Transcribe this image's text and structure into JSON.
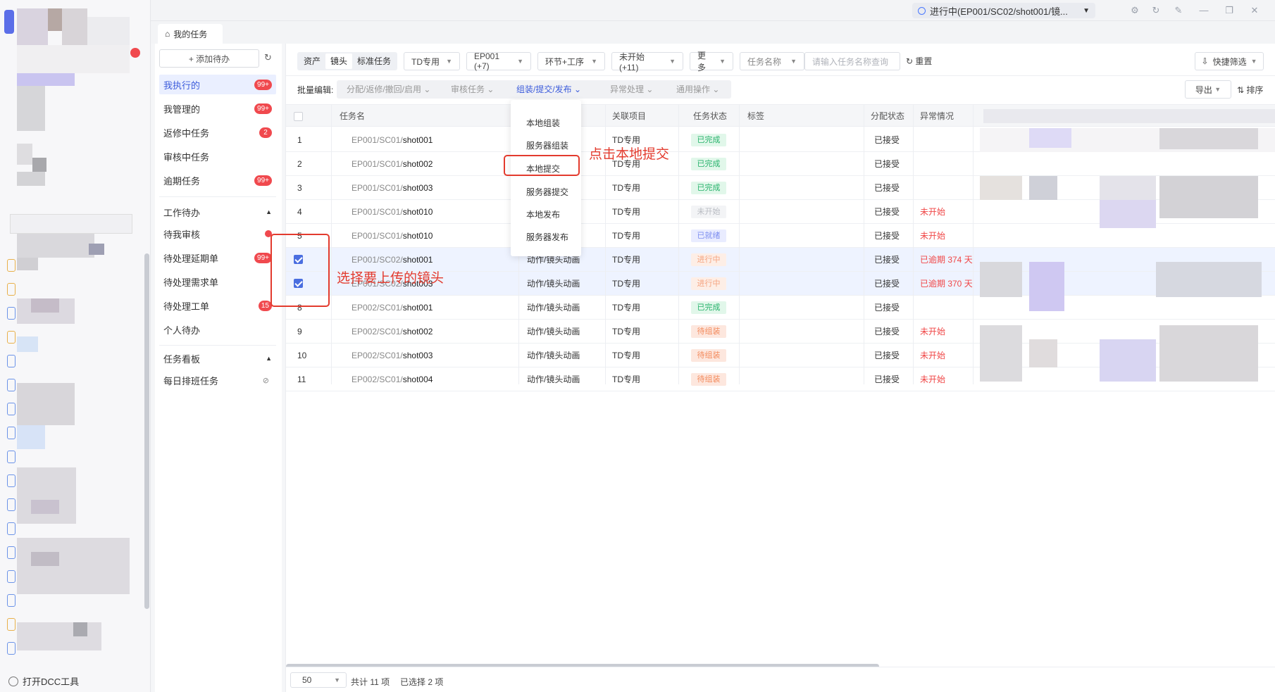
{
  "titlebar": {
    "status": "进行中(EP001/SC02/shot001/镜..."
  },
  "rail": {
    "open_dcc": "打开DCC工具"
  },
  "tab": {
    "label": "我的任务"
  },
  "panel": {
    "add_label": "+ 添加待办",
    "items": [
      {
        "label": "我执行的",
        "badge": "99+"
      },
      {
        "label": "我管理的",
        "badge": "99+"
      },
      {
        "label": "返修中任务",
        "badge": "2"
      },
      {
        "label": "审核中任务",
        "badge": ""
      },
      {
        "label": "逾期任务",
        "badge": "99+"
      }
    ],
    "section_todo": "工作待办",
    "todo_items": [
      {
        "label": "待我审核",
        "badge": ""
      },
      {
        "label": "待处理延期单",
        "badge": "99+"
      },
      {
        "label": "待处理需求单",
        "badge": ""
      },
      {
        "label": "待处理工单",
        "badge": "15"
      },
      {
        "label": "个人待办",
        "badge": ""
      }
    ],
    "section_board": "任务看板",
    "board_items": [
      {
        "label": "每日排班任务"
      }
    ]
  },
  "filters": {
    "segments": [
      "资产",
      "镜头",
      "标准任务"
    ],
    "selects": [
      "TD专用",
      "EP001 (+7)",
      "环节+工序",
      "未开始(+11)",
      "更多",
      "任务名称"
    ],
    "search_placeholder": "请输入任务名称查询",
    "reset": "重置",
    "quick_filter": "快捷筛选"
  },
  "batch": {
    "label": "批量编辑:",
    "items": [
      "分配/返修/撤回/启用",
      "审核任务",
      "组装/提交/发布",
      "异常处理",
      "通用操作"
    ],
    "export": "导出",
    "sort": "排序"
  },
  "table": {
    "headers": [
      "任务名",
      "关联项目",
      "任务状态",
      "标签",
      "分配状态",
      "异常情况"
    ],
    "rows": [
      {
        "no": "1",
        "path": "EP001/SC01/",
        "shot": "shot001",
        "link": "",
        "project": "TD专用",
        "status": "已完成",
        "st": "done",
        "assign": "已接受",
        "issue": "",
        "checked": false
      },
      {
        "no": "2",
        "path": "EP001/SC01/",
        "shot": "shot002",
        "link": "",
        "project": "TD专用",
        "status": "已完成",
        "st": "done",
        "assign": "已接受",
        "issue": "",
        "checked": false
      },
      {
        "no": "3",
        "path": "EP001/SC01/",
        "shot": "shot003",
        "link": "",
        "project": "TD专用",
        "status": "已完成",
        "st": "done",
        "assign": "已接受",
        "issue": "",
        "checked": false
      },
      {
        "no": "4",
        "path": "EP001/SC01/",
        "shot": "shot010",
        "link": "",
        "project": "TD专用",
        "status": "未开始",
        "st": "notstart",
        "assign": "已接受",
        "issue": "未开始",
        "checked": false
      },
      {
        "no": "5",
        "path": "EP001/SC01/",
        "shot": "shot010",
        "link": "",
        "project": "TD专用",
        "status": "已就绪",
        "st": "ready",
        "assign": "已接受",
        "issue": "未开始",
        "checked": false
      },
      {
        "no": "",
        "path": "EP001/SC02/",
        "shot": "shot001",
        "link": "动作/镜头动画",
        "project": "TD专用",
        "status": "进行中",
        "st": "doing",
        "assign": "已接受",
        "issue": "已逾期 374 天",
        "checked": true
      },
      {
        "no": "",
        "path": "EP001/SC02/",
        "shot": "shot003",
        "link": "动作/镜头动画",
        "project": "TD专用",
        "status": "进行中",
        "st": "doing",
        "assign": "已接受",
        "issue": "已逾期 370 天",
        "checked": true
      },
      {
        "no": "8",
        "path": "EP002/SC01/",
        "shot": "shot001",
        "link": "动作/镜头动画",
        "project": "TD专用",
        "status": "已完成",
        "st": "done",
        "assign": "已接受",
        "issue": "",
        "checked": false
      },
      {
        "no": "9",
        "path": "EP002/SC01/",
        "shot": "shot002",
        "link": "动作/镜头动画",
        "project": "TD专用",
        "status": "待组装",
        "st": "toassemble",
        "assign": "已接受",
        "issue": "未开始",
        "checked": false
      },
      {
        "no": "10",
        "path": "EP002/SC01/",
        "shot": "shot003",
        "link": "动作/镜头动画",
        "project": "TD专用",
        "status": "待组装",
        "st": "toassemble",
        "assign": "已接受",
        "issue": "未开始",
        "checked": false
      },
      {
        "no": "11",
        "path": "EP002/SC01/",
        "shot": "shot004",
        "link": "动作/镜头动画",
        "project": "TD专用",
        "status": "待组装",
        "st": "toassemble",
        "assign": "已接受",
        "issue": "未开始",
        "checked": false
      }
    ]
  },
  "menu": {
    "items": [
      "本地组装",
      "服务器组装",
      "本地提交",
      "服务器提交",
      "本地发布",
      "服务器发布"
    ]
  },
  "annotations": {
    "click_local_submit": "点击本地提交",
    "select_shots": "选择要上传的镜头"
  },
  "footer": {
    "page_size": "50",
    "total": "共计 11 项",
    "selected": "已选择 2 项"
  },
  "colors": {
    "accent": "#3b5bdb",
    "annotation": "#e33b2e",
    "badge": "#f0494e"
  }
}
